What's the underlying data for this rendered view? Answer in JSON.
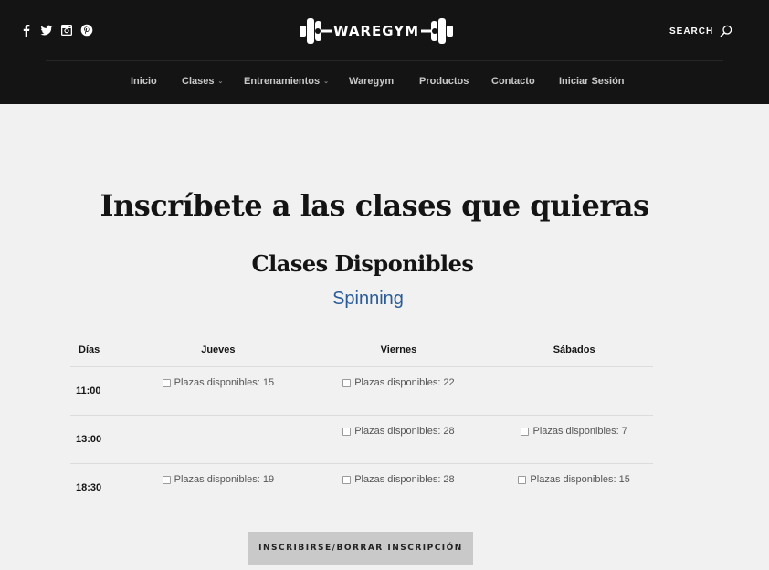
{
  "header": {
    "social": [
      "facebook-icon",
      "twitter-icon",
      "instagram-icon",
      "pinterest-icon"
    ],
    "logo_text": "WAREGYM",
    "search_label": "SEARCH",
    "nav": [
      {
        "label": "Inicio"
      },
      {
        "label": "Clases",
        "has_dropdown": true
      },
      {
        "label": "Entrenamientos",
        "has_dropdown": true
      },
      {
        "label": "Waregym"
      },
      {
        "label": "Productos"
      },
      {
        "label": "Contacto"
      },
      {
        "label": "Iniciar Sesión"
      }
    ]
  },
  "main": {
    "title": "Inscríbete a las clases que quieras",
    "subtitle": "Clases Disponibles",
    "class_name": "Spinning",
    "table": {
      "headers": [
        "Días",
        "Jueves",
        "Viernes",
        "Sábados"
      ],
      "rows": [
        {
          "time": "11:00",
          "cells": [
            "Plazas disponibles: 15",
            "Plazas disponibles: 22",
            ""
          ]
        },
        {
          "time": "13:00",
          "cells": [
            "",
            "Plazas disponibles: 28",
            "Plazas disponibles: 7"
          ]
        },
        {
          "time": "18:30",
          "cells": [
            "Plazas disponibles: 19",
            "Plazas disponibles: 28",
            "Plazas disponibles: 15"
          ]
        }
      ]
    },
    "submit_label": "INSCRIBIRSE/BORRAR INSCRIPCIÓN"
  },
  "colors": {
    "header_bg": "#141414",
    "page_bg": "#f1f1f1",
    "accent_link": "#2a5b98",
    "button_bg": "#c9c9c9"
  }
}
